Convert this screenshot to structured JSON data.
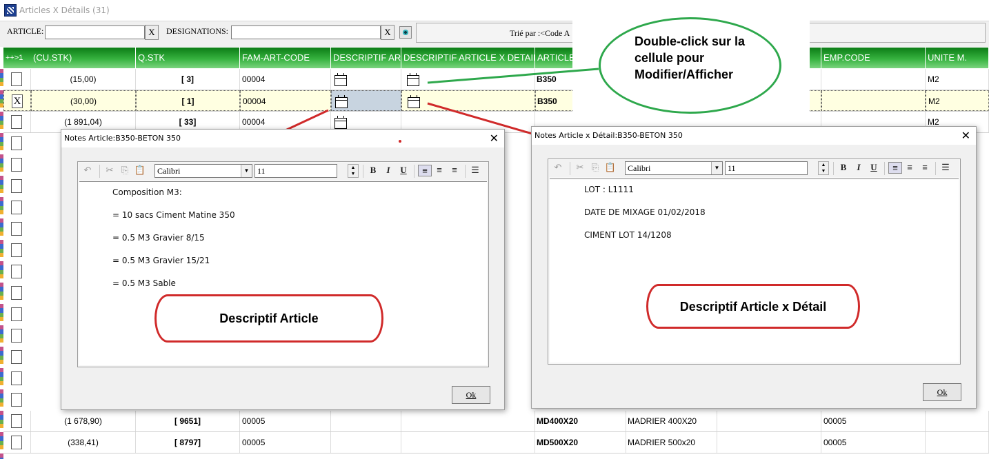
{
  "window": {
    "title": "Articles X Détails (31)"
  },
  "filters": {
    "article_label": "ARTICLE:",
    "designations_label": "DESIGNATIONS:",
    "clear_label": "X",
    "sort_label": "Trié par :<Code A"
  },
  "grid": {
    "headers": [
      "++>1",
      "(CU.STK)",
      "Q.STK",
      "FAM-ART-CODE",
      "DESCRIPTIF AR",
      "DESCRIPTIF ARTICLE X DETAIL",
      "ARTICLE",
      "",
      "",
      "EMP.CODE",
      "UNITE M."
    ],
    "rows": [
      {
        "check": "",
        "cu_stk": "(15,00)",
        "q_stk": "[ 3]",
        "fam": "00004",
        "article": "B350",
        "desig": "",
        "emp": "",
        "unite": "M2"
      },
      {
        "check": "X",
        "cu_stk": "(30,00)",
        "q_stk": "[ 1]",
        "fam": "00004",
        "article": "B350",
        "desig": "",
        "emp": "",
        "unite": "M2"
      },
      {
        "check": "",
        "cu_stk": "(1 891,04)",
        "q_stk": "[ 33]",
        "fam": "00004",
        "article": "",
        "desig": "",
        "emp": "",
        "unite": "M2"
      },
      {
        "check": "",
        "cu_stk": "(1 678,90)",
        "q_stk": "[ 9651]",
        "fam": "00005",
        "article": "MD400X20",
        "desig": "MADRIER 400X20",
        "emp": "00005",
        "unite": ""
      },
      {
        "check": "",
        "cu_stk": "(338,41)",
        "q_stk": "[ 8797]",
        "fam": "00005",
        "article": "MD500X20",
        "desig": "MADRIER 500x20",
        "emp": "00005",
        "unite": ""
      }
    ]
  },
  "dialog_article": {
    "title": "Notes Article:B350-BETON 350",
    "close": "✕",
    "font": "Calibri",
    "size": "11",
    "lines": [
      "Composition M3:",
      "= 10 sacs Ciment Matine 350",
      "= 0.5 M3 Gravier 8/15",
      "= 0.5 M3 Gravier 15/21",
      "= 0.5 M3 Sable"
    ],
    "ok": "Ok"
  },
  "dialog_detail": {
    "title": "Notes Article x Détail:B350-BETON 350",
    "close": "✕",
    "font": "Calibri",
    "size": "11",
    "lines": [
      "LOT : L1111",
      "DATE DE MIXAGE 01/02/2018",
      "CIMENT LOT 14/1208"
    ],
    "ok": "Ok"
  },
  "annotations": {
    "bubble": "Double-click sur la cellule pour Modifier/Afficher",
    "callout_article": "Descriptif Article",
    "callout_detail": "Descriptif Article x Détail"
  },
  "colors": {
    "header_green": "#36b23f",
    "callout_red": "#d02a2a",
    "bubble_green": "#2ea84c",
    "selected_row": "#ffffe1"
  }
}
